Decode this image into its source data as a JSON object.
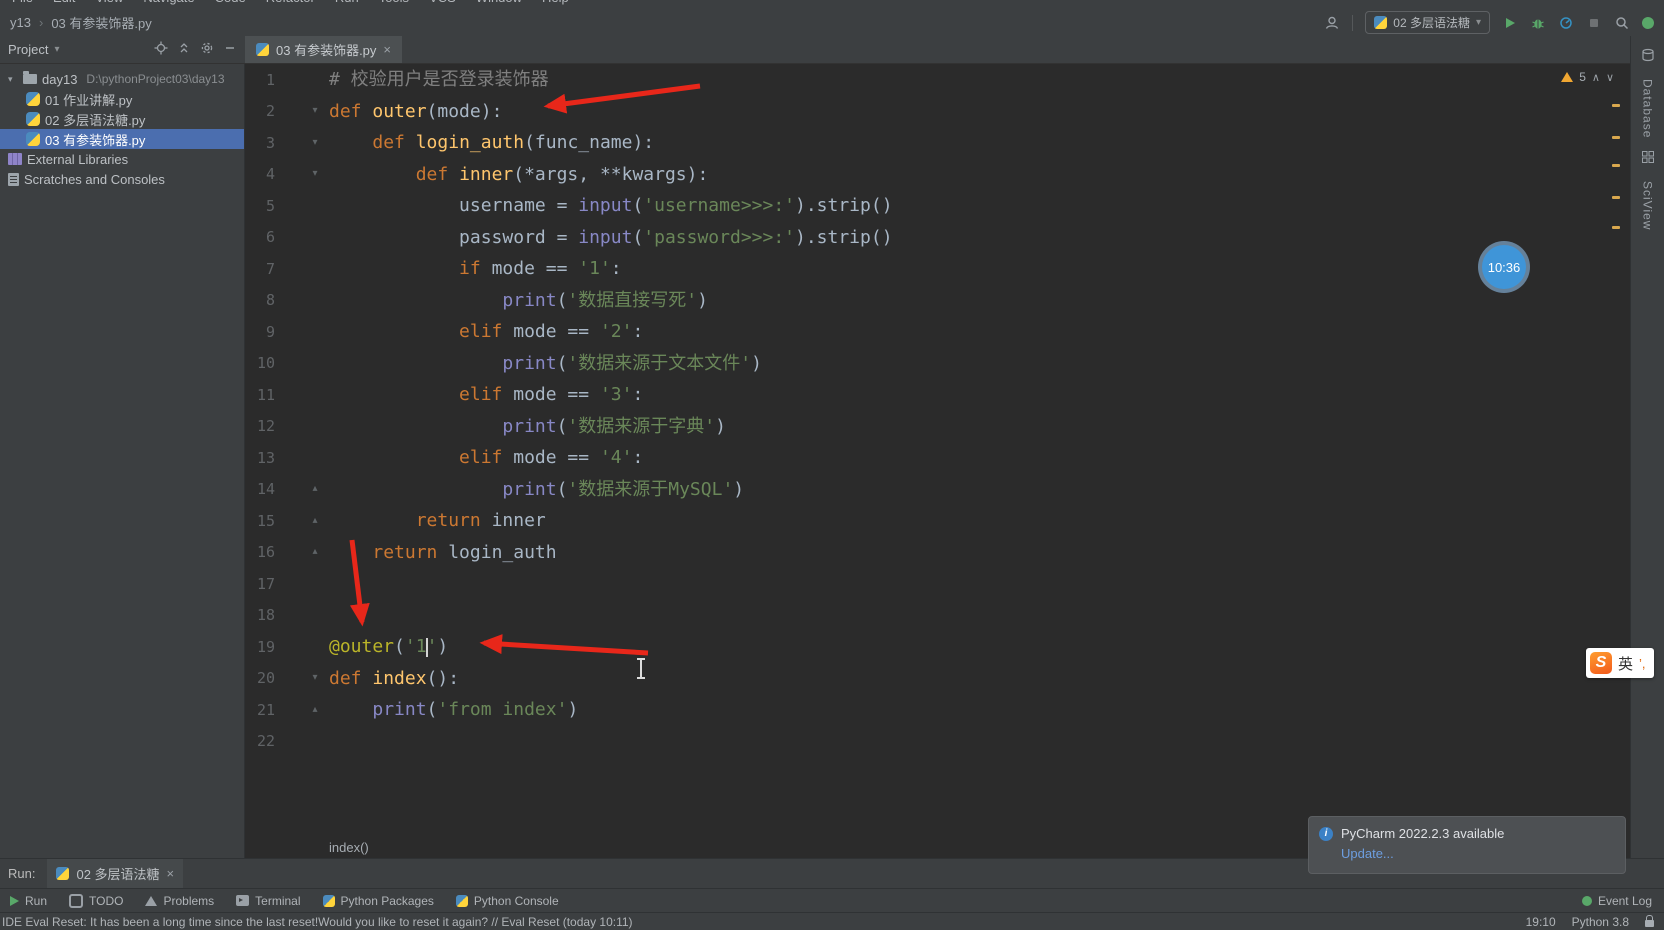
{
  "window": {
    "menu_items": [
      "File",
      "Edit",
      "View",
      "Navigate",
      "Code",
      "Refactor",
      "Run",
      "Tools",
      "VCS",
      "Window",
      "Help"
    ]
  },
  "title_bar": {
    "project_crumb": "y13",
    "file_crumb": "03 有参装饰器.py",
    "run_config": "02 多层语法糖",
    "time_badge": "10:36"
  },
  "project_panel": {
    "header": "Project",
    "items": [
      {
        "label": "day13",
        "path": "D:\\pythonProject03\\day13",
        "icon": "folder",
        "indent": 0,
        "chevron": true,
        "selected": false
      },
      {
        "label": "01 作业讲解.py",
        "icon": "python",
        "indent": 1,
        "chevron": false,
        "selected": false
      },
      {
        "label": "02 多层语法糖.py",
        "icon": "python",
        "indent": 1,
        "chevron": false,
        "selected": false
      },
      {
        "label": "03 有参装饰器.py",
        "icon": "python",
        "indent": 1,
        "chevron": false,
        "selected": true
      },
      {
        "label": "External Libraries",
        "icon": "libraries",
        "indent": 0,
        "chevron": false,
        "selected": false
      },
      {
        "label": "Scratches and Consoles",
        "icon": "scratches",
        "indent": 0,
        "chevron": false,
        "selected": false
      }
    ]
  },
  "editor": {
    "tab": {
      "label": "03 有参装饰器.py",
      "close": "×"
    },
    "inspection": {
      "warnings": "5"
    },
    "breadcrumb": "index()",
    "scroll_marks": [
      40,
      72,
      100,
      132,
      162
    ],
    "lines": [
      {
        "n": 1,
        "fold": "",
        "tokens": [
          {
            "c": "com",
            "t": "# 校验用户是否登录装饰器"
          }
        ]
      },
      {
        "n": 2,
        "fold": "open",
        "tokens": [
          {
            "c": "kw",
            "t": "def "
          },
          {
            "c": "fn",
            "t": "outer"
          },
          {
            "c": "txt",
            "t": "(mode):"
          }
        ]
      },
      {
        "n": 3,
        "fold": "open",
        "tokens": [
          {
            "c": "txt",
            "t": "    "
          },
          {
            "c": "kw",
            "t": "def "
          },
          {
            "c": "fn",
            "t": "login_auth"
          },
          {
            "c": "txt",
            "t": "(func_name):"
          }
        ]
      },
      {
        "n": 4,
        "fold": "open",
        "tokens": [
          {
            "c": "txt",
            "t": "        "
          },
          {
            "c": "kw",
            "t": "def "
          },
          {
            "c": "fn",
            "t": "inner"
          },
          {
            "c": "txt",
            "t": "(*args, **kwargs):"
          }
        ]
      },
      {
        "n": 5,
        "fold": "",
        "tokens": [
          {
            "c": "txt",
            "t": "            username = "
          },
          {
            "c": "bi",
            "t": "input"
          },
          {
            "c": "txt",
            "t": "("
          },
          {
            "c": "str",
            "t": "'username>>>:'"
          },
          {
            "c": "txt",
            "t": ").strip()"
          }
        ]
      },
      {
        "n": 6,
        "fold": "",
        "tokens": [
          {
            "c": "txt",
            "t": "            password = "
          },
          {
            "c": "bi",
            "t": "input"
          },
          {
            "c": "txt",
            "t": "("
          },
          {
            "c": "str",
            "t": "'password>>>:'"
          },
          {
            "c": "txt",
            "t": ").strip()"
          }
        ]
      },
      {
        "n": 7,
        "fold": "",
        "tokens": [
          {
            "c": "txt",
            "t": "            "
          },
          {
            "c": "kw",
            "t": "if "
          },
          {
            "c": "txt",
            "t": "mode == "
          },
          {
            "c": "str",
            "t": "'1'"
          },
          {
            "c": "txt",
            "t": ":"
          }
        ]
      },
      {
        "n": 8,
        "fold": "",
        "tokens": [
          {
            "c": "txt",
            "t": "                "
          },
          {
            "c": "bi",
            "t": "print"
          },
          {
            "c": "txt",
            "t": "("
          },
          {
            "c": "str",
            "t": "'数据直接写死'"
          },
          {
            "c": "txt",
            "t": ")"
          }
        ]
      },
      {
        "n": 9,
        "fold": "",
        "tokens": [
          {
            "c": "txt",
            "t": "            "
          },
          {
            "c": "kw",
            "t": "elif "
          },
          {
            "c": "txt",
            "t": "mode == "
          },
          {
            "c": "str",
            "t": "'2'"
          },
          {
            "c": "txt",
            "t": ":"
          }
        ]
      },
      {
        "n": 10,
        "fold": "",
        "tokens": [
          {
            "c": "txt",
            "t": "                "
          },
          {
            "c": "bi",
            "t": "print"
          },
          {
            "c": "txt",
            "t": "("
          },
          {
            "c": "str",
            "t": "'数据来源于文本文件'"
          },
          {
            "c": "txt",
            "t": ")"
          }
        ]
      },
      {
        "n": 11,
        "fold": "",
        "tokens": [
          {
            "c": "txt",
            "t": "            "
          },
          {
            "c": "kw",
            "t": "elif "
          },
          {
            "c": "txt",
            "t": "mode == "
          },
          {
            "c": "str",
            "t": "'3'"
          },
          {
            "c": "txt",
            "t": ":"
          }
        ]
      },
      {
        "n": 12,
        "fold": "",
        "tokens": [
          {
            "c": "txt",
            "t": "                "
          },
          {
            "c": "bi",
            "t": "print"
          },
          {
            "c": "txt",
            "t": "("
          },
          {
            "c": "str",
            "t": "'数据来源于字典'"
          },
          {
            "c": "txt",
            "t": ")"
          }
        ]
      },
      {
        "n": 13,
        "fold": "",
        "tokens": [
          {
            "c": "txt",
            "t": "            "
          },
          {
            "c": "kw",
            "t": "elif "
          },
          {
            "c": "txt",
            "t": "mode == "
          },
          {
            "c": "str",
            "t": "'4'"
          },
          {
            "c": "txt",
            "t": ":"
          }
        ]
      },
      {
        "n": 14,
        "fold": "end",
        "tokens": [
          {
            "c": "txt",
            "t": "                "
          },
          {
            "c": "bi",
            "t": "print"
          },
          {
            "c": "txt",
            "t": "("
          },
          {
            "c": "str",
            "t": "'数据来源于MySQL'"
          },
          {
            "c": "txt",
            "t": ")"
          }
        ]
      },
      {
        "n": 15,
        "fold": "end",
        "tokens": [
          {
            "c": "txt",
            "t": "        "
          },
          {
            "c": "kw",
            "t": "return "
          },
          {
            "c": "txt",
            "t": "inner"
          }
        ]
      },
      {
        "n": 16,
        "fold": "end",
        "tokens": [
          {
            "c": "txt",
            "t": "    "
          },
          {
            "c": "kw",
            "t": "return "
          },
          {
            "c": "txt",
            "t": "login_auth"
          }
        ]
      },
      {
        "n": 17,
        "fold": "",
        "tokens": []
      },
      {
        "n": 18,
        "fold": "",
        "tokens": []
      },
      {
        "n": 19,
        "fold": "",
        "tokens": [
          {
            "c": "dec",
            "t": "@outer"
          },
          {
            "c": "txt",
            "t": "("
          },
          {
            "c": "str",
            "t": "'1"
          },
          {
            "c": "caret",
            "t": ""
          },
          {
            "c": "str",
            "t": "'"
          },
          {
            "c": "txt",
            "t": ")"
          }
        ]
      },
      {
        "n": 20,
        "fold": "open",
        "tokens": [
          {
            "c": "kw",
            "t": "def "
          },
          {
            "c": "fn",
            "t": "index"
          },
          {
            "c": "txt",
            "t": "():"
          }
        ]
      },
      {
        "n": 21,
        "fold": "end",
        "tokens": [
          {
            "c": "txt",
            "t": "    "
          },
          {
            "c": "bi",
            "t": "print"
          },
          {
            "c": "txt",
            "t": "("
          },
          {
            "c": "str",
            "t": "'from index'"
          },
          {
            "c": "txt",
            "t": ")"
          }
        ]
      },
      {
        "n": 22,
        "fold": "",
        "tokens": []
      }
    ]
  },
  "run_panel": {
    "label": "Run:",
    "tab": "02 多层语法糖",
    "close": "×"
  },
  "toolbar": {
    "left": [
      {
        "icon": "run-play",
        "label": "Run"
      },
      {
        "icon": "todo",
        "label": "TODO"
      },
      {
        "icon": "problems",
        "label": "Problems"
      },
      {
        "icon": "terminal",
        "label": "Terminal"
      },
      {
        "icon": "python",
        "label": "Python Packages"
      },
      {
        "icon": "python",
        "label": "Python Console"
      }
    ],
    "right": [
      {
        "icon": "event",
        "label": "Event Log"
      }
    ]
  },
  "status_bar": {
    "message": "IDE Eval Reset: It has been a long time since the last reset!Would you like to reset it again? // Eval Reset (today 10:11)",
    "time": "19:10",
    "interpreter": "Python 3.8"
  },
  "notification": {
    "title": "PyCharm 2022.2.3 available",
    "link": "Update..."
  },
  "ime": {
    "logo": "S",
    "mode": "英",
    "punct": "’,"
  },
  "right_strip": {
    "labels": [
      "Database",
      "SciView"
    ]
  },
  "colors": {
    "keyword": "#cc7832",
    "function": "#ffc66d",
    "string": "#6a8759",
    "builtin": "#8888c6",
    "comment": "#808080",
    "decorator": "#bbb529",
    "text": "#a9b7c6",
    "selection": "#4b6eaf",
    "arrow": "#e8271a",
    "panel": "#3c3f41",
    "editor_bg": "#2b2b2b"
  }
}
